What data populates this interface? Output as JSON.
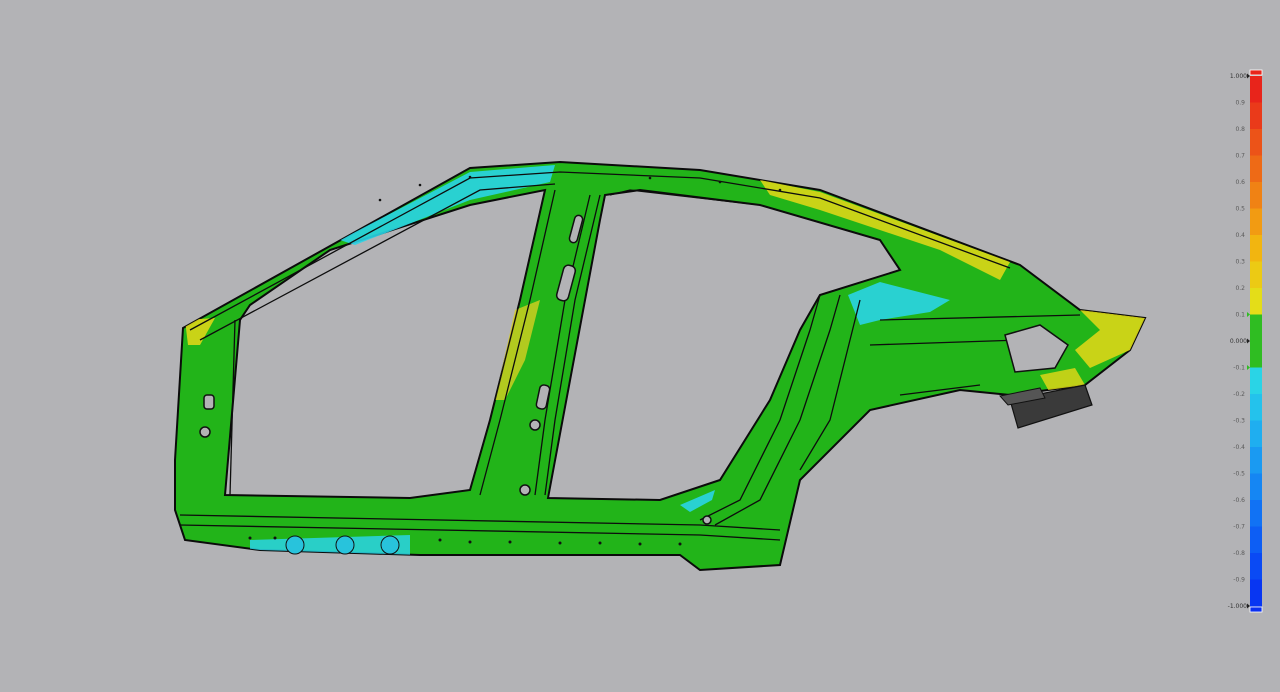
{
  "viewport": {
    "background": "#b3b3b6",
    "part_colors": {
      "base": "#22b419",
      "dark_line": "#111111",
      "cyan": "#2ad4e6",
      "yellow": "#dcd617",
      "orange": "#e7a21b"
    }
  },
  "color_legend": {
    "labels": [
      {
        "text": "1.000",
        "major": true
      },
      {
        "text": "0.9"
      },
      {
        "text": "0.8"
      },
      {
        "text": "0.7"
      },
      {
        "text": "0.6"
      },
      {
        "text": "0.5"
      },
      {
        "text": "0.4"
      },
      {
        "text": "0.3"
      },
      {
        "text": "0.2"
      },
      {
        "text": "0.1",
        "marker": true
      },
      {
        "text": "0.000",
        "major": true
      },
      {
        "text": "-0.1",
        "marker": true
      },
      {
        "text": "-0.2"
      },
      {
        "text": "-0.3"
      },
      {
        "text": "-0.4"
      },
      {
        "text": "-0.5"
      },
      {
        "text": "-0.6"
      },
      {
        "text": "-0.7"
      },
      {
        "text": "-0.8"
      },
      {
        "text": "-0.9"
      },
      {
        "text": "-1.000",
        "major": true
      }
    ],
    "colors": [
      "#e8241b",
      "#ea3a1a",
      "#ec5318",
      "#ee6a16",
      "#f08214",
      "#f29b12",
      "#f2b510",
      "#ecca14",
      "#e4dd18",
      "#2fbd22",
      "#2fbd22",
      "#2ad4e6",
      "#24c2ec",
      "#1faef0",
      "#1a9af2",
      "#1586f3",
      "#1172f4",
      "#0d5ef4",
      "#0a4af4",
      "#0836f2"
    ]
  }
}
